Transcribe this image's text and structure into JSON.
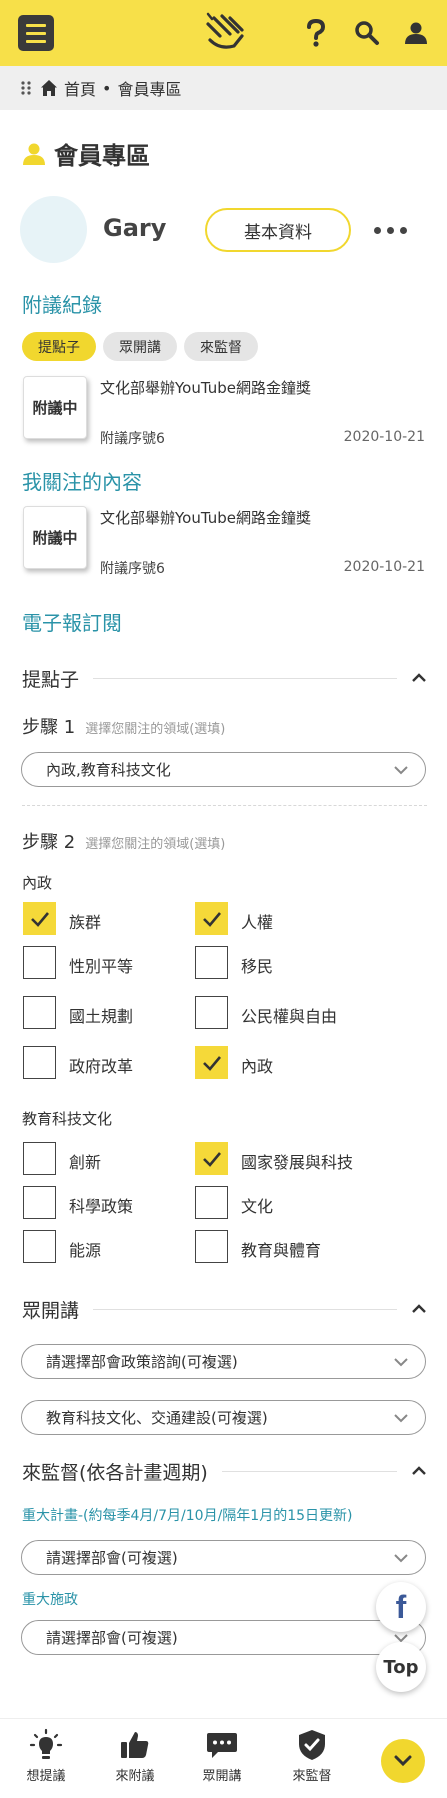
{
  "header": {
    "menu_icon": "hamburger-menu-icon",
    "logo_icon": "hands-logo-icon",
    "help_icon": "question-mark-icon",
    "search_icon": "search-icon",
    "user_icon": "user-icon"
  },
  "breadcrumb": {
    "home": "首頁",
    "separator": "•",
    "current": "會員專區"
  },
  "page": {
    "title": "會員專區"
  },
  "profile": {
    "username": "Gary",
    "basic_info_label": "基本資料"
  },
  "sections": {
    "proposals": "附議紀錄",
    "following": "我關注的內容",
    "newsletter": "電子報訂閱"
  },
  "tabs": [
    {
      "label": "提點子",
      "active": true
    },
    {
      "label": "眾開講",
      "active": false
    },
    {
      "label": "來監督",
      "active": false
    }
  ],
  "proposal_item": {
    "badge": "附議中",
    "title": "文化部舉辦YouTube網路金鐘獎",
    "sub": "附議序號6",
    "date": "2020-10-21"
  },
  "following_item": {
    "badge": "附議中",
    "title": "文化部舉辦YouTube網路金鐘獎",
    "sub": "附議序號6",
    "date": "2020-10-21"
  },
  "newsletter": {
    "ideas": {
      "title": "提點子",
      "step1_label": "步驟 1",
      "step1_hint": "選擇您關注的領域(選填)",
      "step1_select": "內政,教育科技文化",
      "step2_label": "步驟 2",
      "step2_hint": "選擇您關注的領域(選填)",
      "groups": [
        {
          "name": "內政",
          "options": [
            {
              "label": "族群",
              "checked": true
            },
            {
              "label": "人權",
              "checked": true
            },
            {
              "label": "性別平等",
              "checked": false
            },
            {
              "label": "移民",
              "checked": false
            },
            {
              "label": "國土規劃",
              "checked": false
            },
            {
              "label": "公民權與自由",
              "checked": false
            },
            {
              "label": "政府改革",
              "checked": false
            },
            {
              "label": "內政",
              "checked": true
            }
          ]
        },
        {
          "name": "教育科技文化",
          "options": [
            {
              "label": "創新",
              "checked": false
            },
            {
              "label": "國家發展與科技",
              "checked": true
            },
            {
              "label": "科學政策",
              "checked": false
            },
            {
              "label": "文化",
              "checked": false
            },
            {
              "label": "能源",
              "checked": false
            },
            {
              "label": "教育與體育",
              "checked": false
            }
          ]
        }
      ]
    },
    "forum": {
      "title": "眾開講",
      "select1": "請選擇部會政策諮詢(可複選)",
      "select2": "教育科技文化、交通建設(可複選)"
    },
    "supervise": {
      "title": "來監督(依各計畫週期)",
      "major_plans_label": "重大計畫-(約每季4月/7月/10月/隔年1月的15日更新)",
      "major_plans_select": "請選擇部會(可複選)",
      "major_works_label": "重大施政",
      "major_works_select": "請選擇部會(可複選)"
    }
  },
  "floating": {
    "facebook": "f",
    "top": "Top"
  },
  "bottom_nav": [
    {
      "label": "想提議",
      "icon": "lightbulb-icon"
    },
    {
      "label": "來附議",
      "icon": "thumbs-up-icon"
    },
    {
      "label": "眾開講",
      "icon": "chat-bubble-icon"
    },
    {
      "label": "來監督",
      "icon": "shield-check-icon"
    }
  ],
  "colors": {
    "brand_yellow": "#f7e049",
    "accent_teal": "#2a93a8",
    "checkbox_on": "#f5d939"
  }
}
